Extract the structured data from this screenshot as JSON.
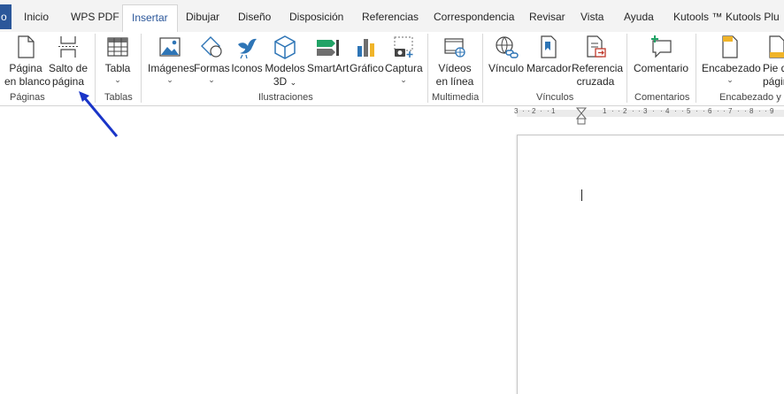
{
  "tabs": {
    "file": "o",
    "items": [
      {
        "label": "Inicio"
      },
      {
        "label": "WPS PDF"
      },
      {
        "label": "Insertar"
      },
      {
        "label": "Dibujar"
      },
      {
        "label": "Diseño"
      },
      {
        "label": "Disposición"
      },
      {
        "label": "Referencias"
      },
      {
        "label": "Correspondencia"
      },
      {
        "label": "Revisar"
      },
      {
        "label": "Vista"
      },
      {
        "label": "Ayuda"
      },
      {
        "label": "Kutools ™"
      },
      {
        "label": "Kutools Plu"
      }
    ],
    "active": "Insertar"
  },
  "ribbon": {
    "paginas": {
      "blank_page": [
        "Página",
        "en blanco"
      ],
      "page_break": [
        "Salto de",
        "página"
      ],
      "group": "Páginas"
    },
    "tablas": {
      "table": "Tabla",
      "group": "Tablas"
    },
    "ilustraciones": {
      "images": "Imágenes",
      "shapes": "Formas",
      "icons": "Iconos",
      "models3d": [
        "Modelos",
        "3D"
      ],
      "smartart": "SmartArt",
      "chart": "Gráfico",
      "screenshot": "Captura",
      "group": "Ilustraciones"
    },
    "multimedia": {
      "video": [
        "Vídeos",
        "en línea"
      ],
      "group": "Multimedia"
    },
    "vinculos": {
      "link": "Vínculo",
      "bookmark": "Marcador",
      "crossref": [
        "Referencia",
        "cruzada"
      ],
      "group": "Vínculos"
    },
    "comentarios": {
      "comment": "Comentario",
      "group": "Comentarios"
    },
    "encabezado": {
      "header": "Encabezado",
      "footer": [
        "Pie d",
        "págin"
      ],
      "group": "Encabezado y p"
    }
  },
  "ruler": {
    "marks": [
      "3",
      "2",
      "1",
      "1",
      "2",
      "3",
      "4",
      "5",
      "6",
      "7",
      "8",
      "9"
    ]
  },
  "colors": {
    "accent": "#2b579a",
    "arrow": "#1a35c8",
    "icon_blue": "#2e75b6",
    "icon_green": "#21a366"
  }
}
